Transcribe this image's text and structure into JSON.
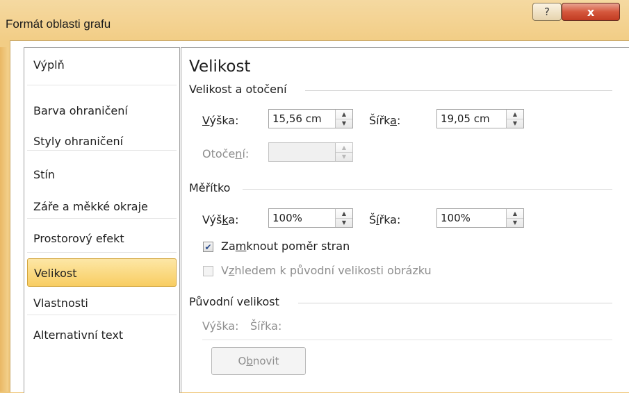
{
  "window": {
    "title": "Formát oblasti grafu",
    "help_label": "?",
    "close_label": "x"
  },
  "nav": {
    "items": [
      {
        "label": "Výplň"
      },
      {
        "label": "Barva ohraničení"
      },
      {
        "label": "Styly ohraničení"
      },
      {
        "label": "Stín"
      },
      {
        "label": "Záře a měkké okraje"
      },
      {
        "label": "Prostorový efekt"
      },
      {
        "label": "Velikost"
      },
      {
        "label": "Vlastnosti"
      },
      {
        "label": "Alternativní text"
      }
    ],
    "selected": "Velikost"
  },
  "panel": {
    "heading": "Velikost",
    "size_rotation": {
      "title": "Velikost a otočení",
      "height_label": "Výška:",
      "height_value": "15,56 cm",
      "width_label": "Šířka:",
      "width_value": "19,05 cm",
      "rotation_label": "Otočení:",
      "rotation_value": ""
    },
    "scale": {
      "title": "Měřítko",
      "height_label": "Výška:",
      "height_value": "100%",
      "width_label": "Šířka:",
      "width_value": "100%",
      "lock_aspect_label": "Zamknout poměr stran",
      "lock_aspect_checked": true,
      "relative_original_label": "Vzhledem k původní velikosti obrázku",
      "relative_original_checked": false
    },
    "original": {
      "title": "Původní velikost",
      "height_label": "Výška:",
      "width_label": "Šířka:",
      "reset_label": "Obnovit"
    }
  }
}
